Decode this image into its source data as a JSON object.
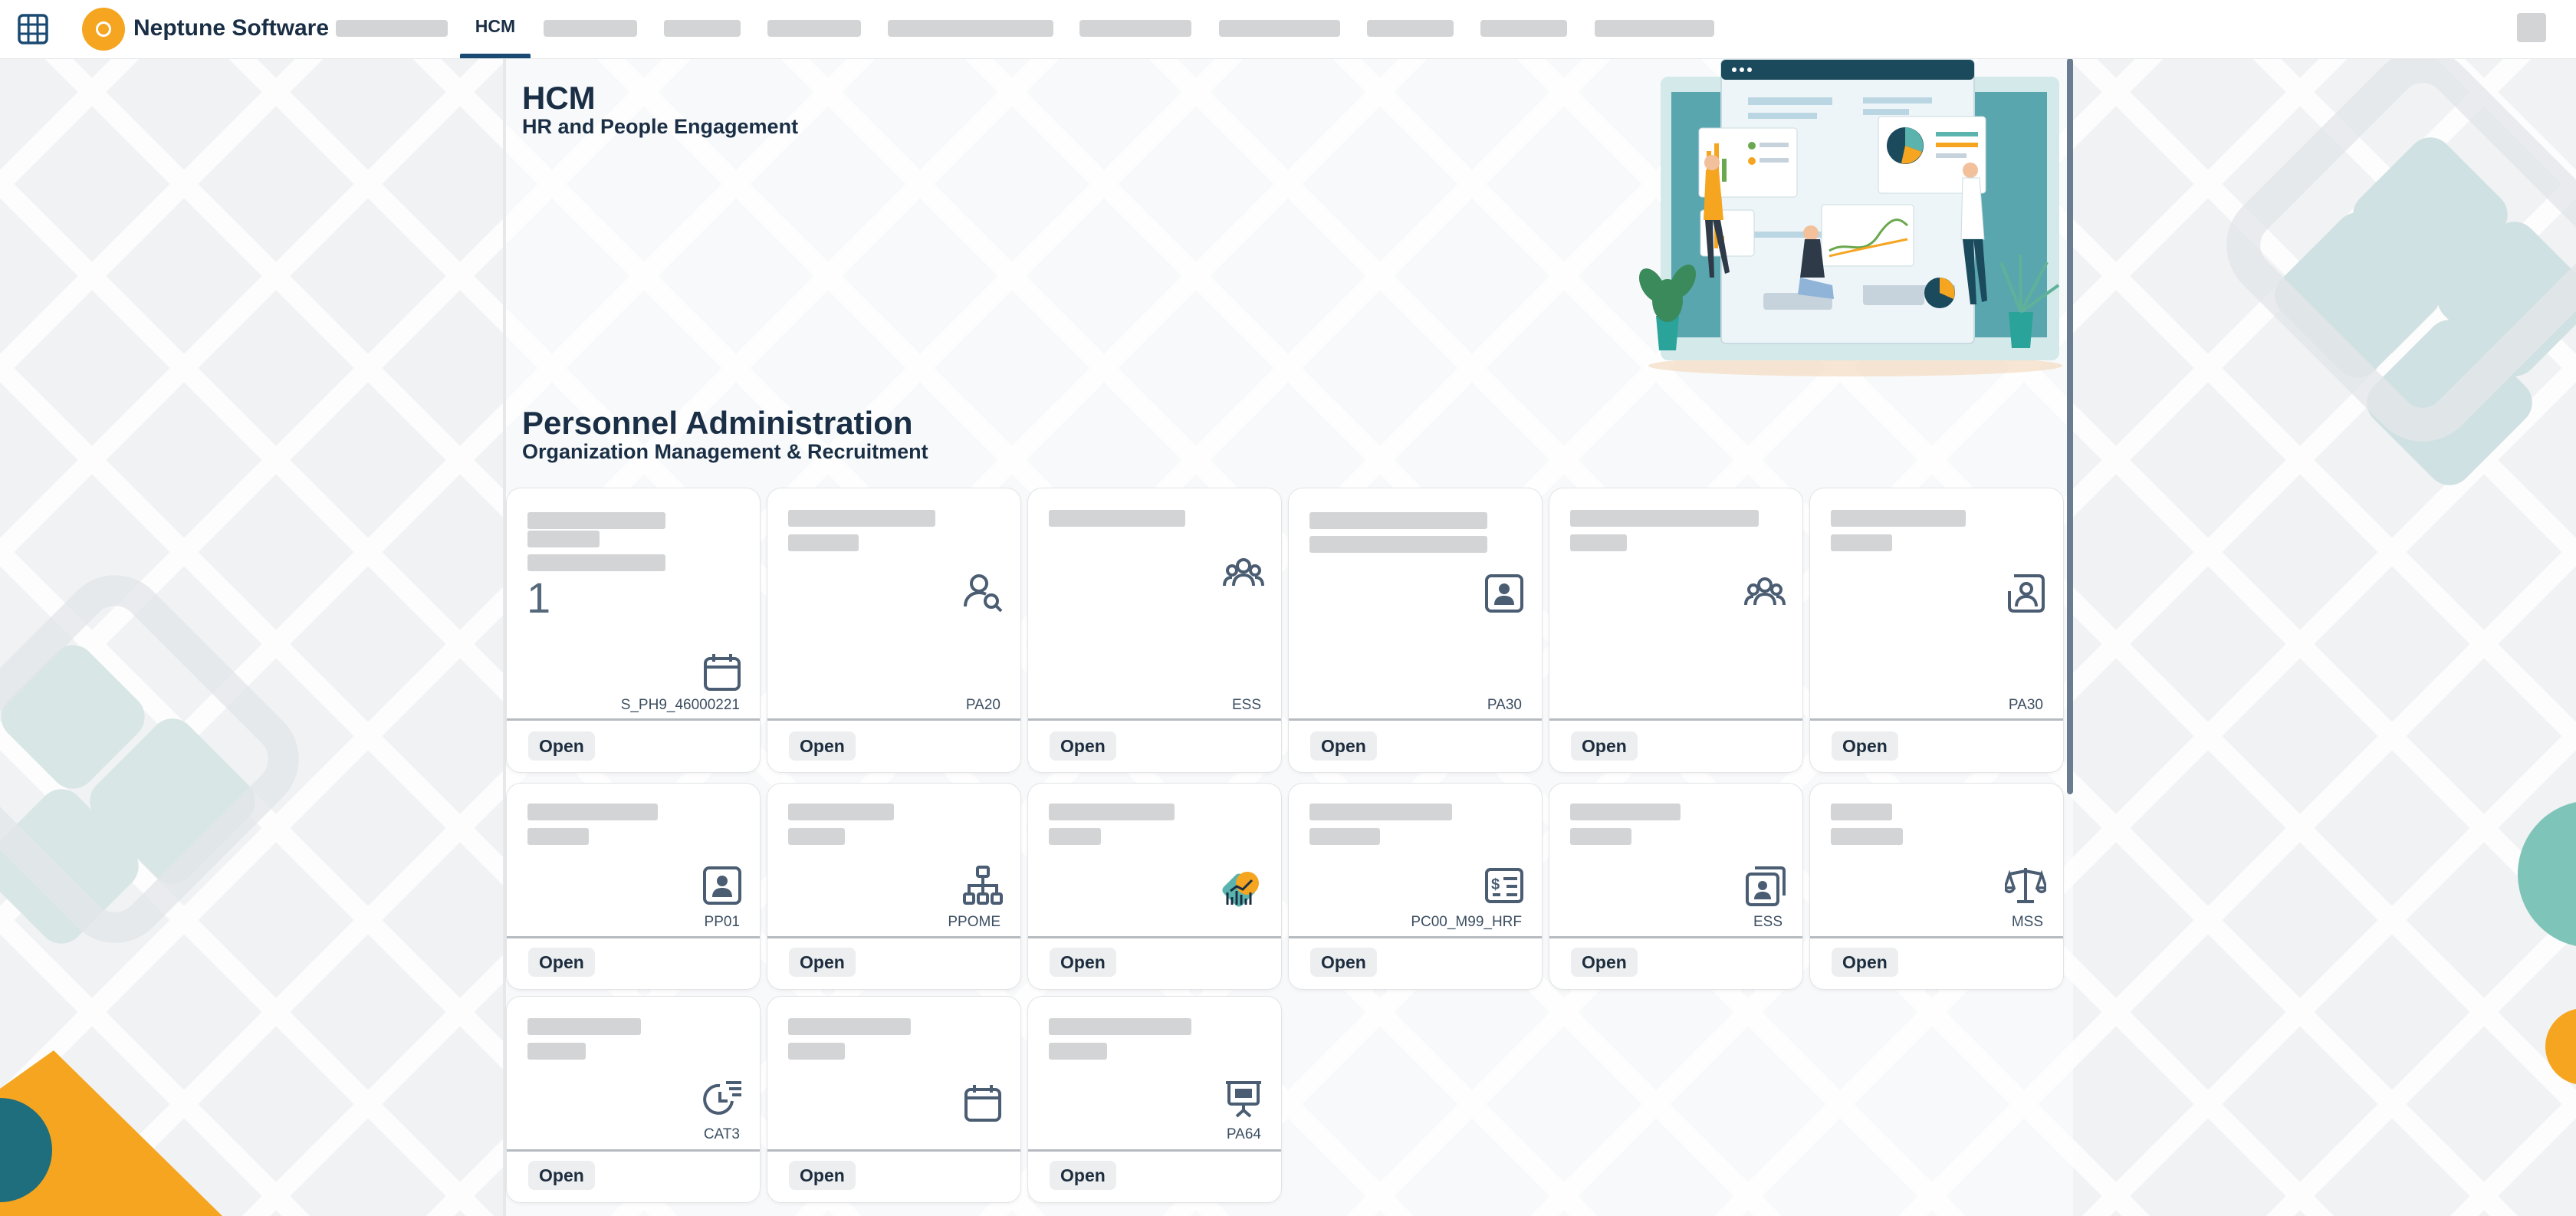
{
  "header": {
    "brand": "Neptune Software",
    "active_tab": "HCM",
    "icons": {
      "apps": "grid-icon",
      "logo": "neptune-logo-icon",
      "user": "user-avatar"
    }
  },
  "page": {
    "title": "HCM",
    "subtitle": "HR and People Engagement",
    "section_title": "Personnel Administration",
    "section_subtitle": "Organization Management & Recruitment"
  },
  "tiles": [
    {
      "code": "S_PH9_46000221",
      "number": "1",
      "icon": "calendar-icon",
      "button": "Open"
    },
    {
      "code": "PA20",
      "icon": "employee-lookup-icon",
      "button": "Open"
    },
    {
      "code": "ESS",
      "icon": "group-icon",
      "button": "Open"
    },
    {
      "code": "PA30",
      "icon": "contact-card-icon",
      "button": "Open"
    },
    {
      "code": "",
      "icon": "group-icon",
      "button": "Open"
    },
    {
      "code": "PA30",
      "icon": "person-placeholder-icon",
      "button": "Open"
    },
    {
      "code": "PP01",
      "icon": "contact-card-icon",
      "button": "Open"
    },
    {
      "code": "PPOME",
      "icon": "org-chart-icon",
      "button": "Open"
    },
    {
      "code": "",
      "icon": "analytics-badge-icon",
      "button": "Open"
    },
    {
      "code": "PC00_M99_HRF",
      "icon": "payroll-icon",
      "button": "Open"
    },
    {
      "code": "ESS",
      "icon": "documents-icon",
      "button": "Open"
    },
    {
      "code": "MSS",
      "icon": "balance-scale-icon",
      "button": "Open"
    },
    {
      "code": "CAT3",
      "icon": "time-report-icon",
      "button": "Open"
    },
    {
      "code": "",
      "icon": "calendar-icon",
      "button": "Open"
    },
    {
      "code": "PA64",
      "icon": "presentation-icon",
      "button": "Open"
    }
  ],
  "colors": {
    "brand_orange": "#f5a51f",
    "text_dark": "#1a2f45",
    "icon": "#4a5d72",
    "placeholder": "#d3d4d6",
    "teal": "#5ab4ad"
  }
}
